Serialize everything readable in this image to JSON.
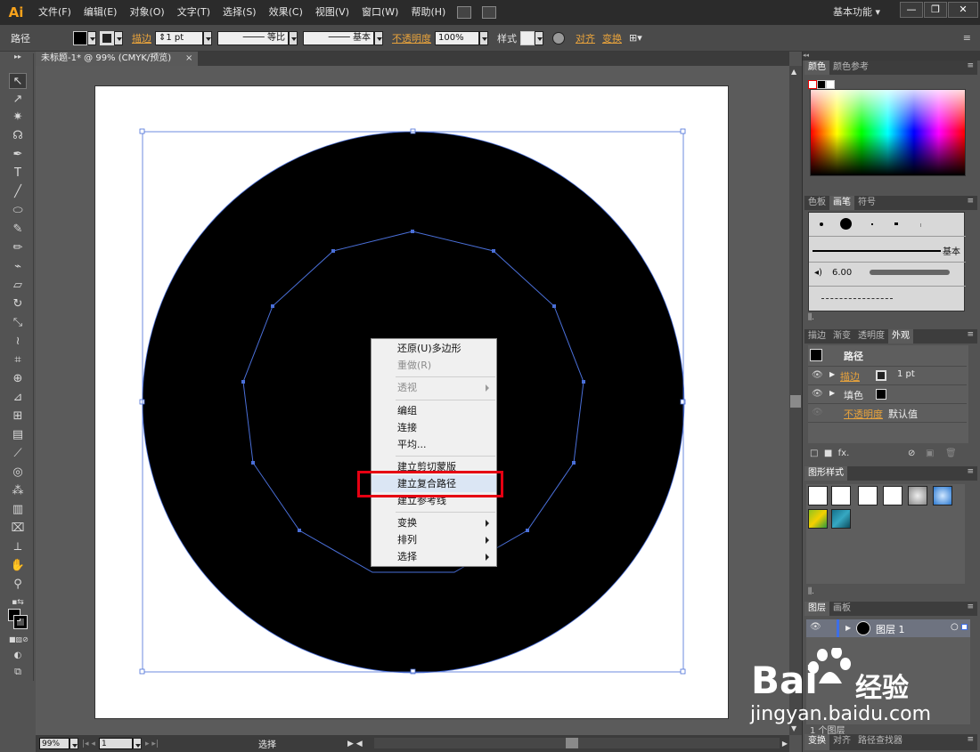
{
  "app": {
    "logo": "Ai",
    "menus": [
      "文件(F)",
      "编辑(E)",
      "对象(O)",
      "文字(T)",
      "选择(S)",
      "效果(C)",
      "视图(V)",
      "窗口(W)",
      "帮助(H)"
    ],
    "workspace": "基本功能"
  },
  "control_bar": {
    "object_type": "路径",
    "stroke_label": "描边",
    "stroke_weight": "1 pt",
    "profile_label": "等比",
    "brush_label": "基本",
    "opacity_label": "不透明度",
    "opacity_value": "100%",
    "style_label": "样式",
    "align_label": "对齐",
    "transform_label": "变换"
  },
  "document": {
    "tab_title": "未标题-1* @ 99% (CMYK/预览)",
    "close": "×"
  },
  "status_bar": {
    "zoom": "99%",
    "artboard": "1",
    "mode": "选择"
  },
  "context_menu": {
    "items": [
      {
        "label": "还原(U)多边形",
        "disabled": false
      },
      {
        "label": "重做(R)",
        "disabled": true
      },
      {
        "label": "透视",
        "disabled": true,
        "submenu": true
      },
      {
        "label": "编组",
        "disabled": false
      },
      {
        "label": "连接",
        "disabled": false
      },
      {
        "label": "平均...",
        "disabled": false
      },
      {
        "label": "建立剪切蒙版",
        "disabled": false
      },
      {
        "label": "建立复合路径",
        "disabled": false,
        "highlighted": true
      },
      {
        "label": "建立参考线",
        "disabled": false
      },
      {
        "label": "变换",
        "disabled": false,
        "submenu": true
      },
      {
        "label": "排列",
        "disabled": false,
        "submenu": true
      },
      {
        "label": "选择",
        "disabled": false,
        "submenu": true
      }
    ]
  },
  "panels": {
    "color": {
      "tabs": [
        "颜色",
        "颜色参考"
      ]
    },
    "brushes": {
      "tabs": [
        "色板",
        "画笔",
        "符号"
      ],
      "basic_label": "基本",
      "size": "6.00"
    },
    "appearance": {
      "tabs": [
        "描边",
        "渐变",
        "透明度",
        "外观"
      ],
      "header": "路径",
      "stroke_label": "描边",
      "stroke_value": "1 pt",
      "fill_label": "填色",
      "opacity_label": "不透明度",
      "opacity_value": "默认值",
      "fx": "fx."
    },
    "graphic_styles": {
      "tabs": [
        "图形样式"
      ]
    },
    "layers": {
      "tabs": [
        "图层",
        "画板"
      ],
      "layer_name": "图层 1",
      "count": "1 个图层"
    },
    "bottom_tabs": [
      "变换",
      "对齐",
      "路径查找器"
    ]
  },
  "watermark": {
    "brand": "Bai",
    "brand_cn": "经验",
    "url": "jingyan.baidu.com"
  },
  "colors": {
    "accent_orange": "#e8a33c",
    "selection_blue": "#4a6fd8",
    "highlight_red": "#e60012"
  }
}
